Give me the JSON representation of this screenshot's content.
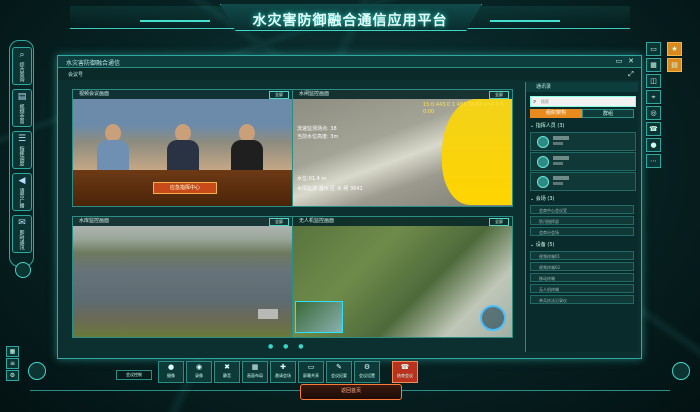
{
  "app": {
    "title": "水灾害防御融合通信应用平台"
  },
  "left_rail": {
    "items": [
      {
        "icon": "search-icon",
        "label": "综合查询"
      },
      {
        "icon": "doc-icon",
        "label": "视频会商"
      },
      {
        "icon": "list-icon",
        "label": "指挥调度"
      },
      {
        "icon": "megaphone-icon",
        "label": "语音广播"
      },
      {
        "icon": "chat-icon",
        "label": "即时通讯"
      }
    ]
  },
  "window": {
    "title": "水灾害防御融合通信",
    "toolbar": "会议号"
  },
  "panes": {
    "p1": {
      "title": "视频会议画面",
      "btn": "全屏"
    },
    "p2": {
      "title": "水闸监控画面",
      "btn": "全屏",
      "overlay_top": "15:0:443.0 1 481:34.83 x=0 2 5 0:00",
      "overlay_lines": [
        "流速监测测点: 38",
        "当前水位高度: 3m"
      ],
      "overlay_bottom": [
        "水位:01.4 m",
        "水情监测 温州 区 水 闸   3641"
      ]
    },
    "p3": {
      "title": "水库监控画面",
      "btn": "全屏"
    },
    "p4": {
      "title": "无人机监控画面",
      "btn": "全屏"
    }
  },
  "desk_sign": "应急指挥中心",
  "pager": "● ● ●",
  "panel": {
    "title": "通讯录",
    "search_placeholder": "搜索",
    "tab_on": "组织架构",
    "tab_off": "群组",
    "group1": "指挥人员 (3)",
    "group2": "会场 (3)",
    "group3": "设备 (5)",
    "rows_g2": [
      "会商中心会议室",
      "防汛指挥部",
      "会商分会场"
    ],
    "rows_g3": [
      "视频终端01",
      "视频终端02",
      "移动终端",
      "无人机终端",
      "单兵执法记录仪"
    ]
  },
  "toolbar": {
    "label": "会议控制",
    "buttons": [
      "摄像",
      "录像",
      "静音",
      "画面布局",
      "邀请会场",
      "屏幕共享",
      "会议纪要",
      "会议设置",
      "结束会议"
    ]
  },
  "bottom": {
    "label": "返回首页"
  },
  "colors": {
    "accent": "#3ecbc0",
    "orange": "#e88b1f",
    "red": "#b8321e"
  }
}
